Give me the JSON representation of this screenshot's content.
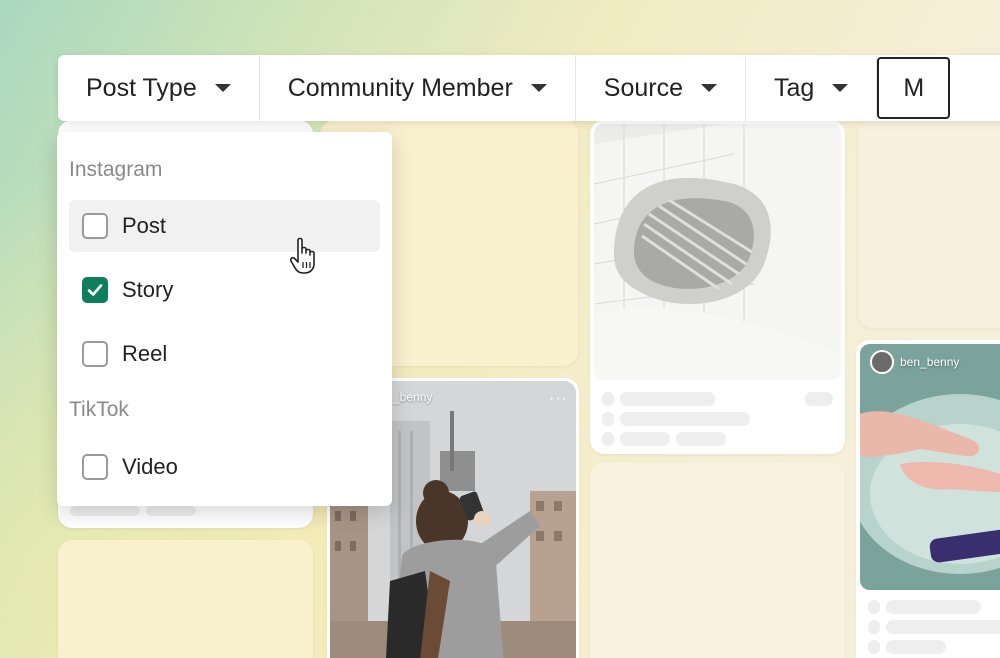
{
  "filters": [
    {
      "label": "Post Type"
    },
    {
      "label": "Community Member"
    },
    {
      "label": "Source"
    },
    {
      "label": "Tag"
    },
    {
      "label": "M"
    }
  ],
  "dropdown": {
    "groups": [
      {
        "label": "Instagram",
        "options": [
          {
            "label": "Post",
            "checked": false,
            "hovered": true
          },
          {
            "label": "Story",
            "checked": true,
            "hovered": false
          },
          {
            "label": "Reel",
            "checked": false,
            "hovered": false
          }
        ]
      },
      {
        "label": "TikTok",
        "options": [
          {
            "label": "Video",
            "checked": false,
            "hovered": false
          }
        ]
      }
    ]
  },
  "posts": [
    {
      "username": "_benny"
    },
    {
      "username": "ben_benny"
    }
  ],
  "colors": {
    "accent": "#0e7f5a",
    "card": "#ffffff",
    "background": "#f3edd6"
  },
  "icons": {
    "caret": "chevron-down-icon",
    "check": "checkmark-icon",
    "cursor": "hand-pointer-icon",
    "more": "more-icon"
  }
}
